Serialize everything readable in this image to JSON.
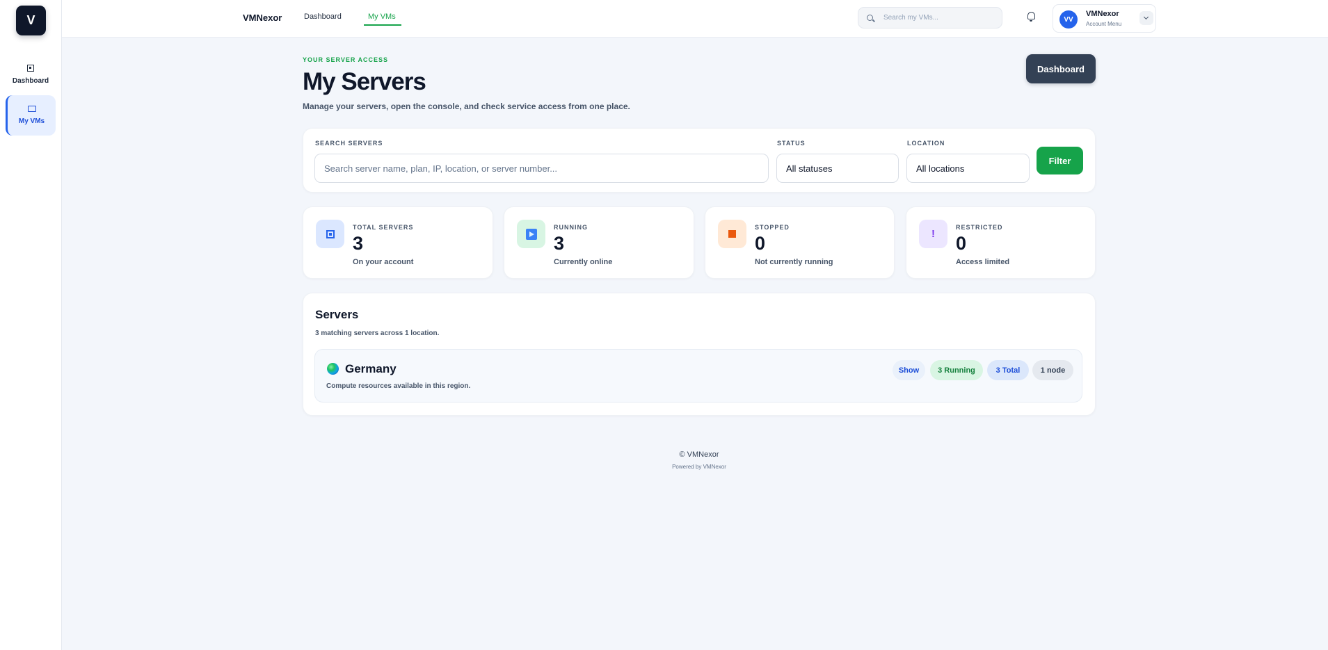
{
  "sidebar": {
    "logo_letter": "V",
    "items": [
      {
        "label": "Dashboard",
        "icon": "dashboard-icon"
      },
      {
        "label": "My VMs",
        "icon": "monitor-icon"
      }
    ]
  },
  "topbar": {
    "brand": "VMNexor",
    "nav": [
      {
        "label": "Dashboard"
      },
      {
        "label": "My VMs"
      }
    ],
    "search_placeholder": "Search my VMs...",
    "account": {
      "initials": "VV",
      "name": "VMNexor",
      "subtitle": "Account Menu"
    }
  },
  "header": {
    "eyebrow": "YOUR SERVER ACCESS",
    "title": "My Servers",
    "subtitle": "Manage your servers, open the console, and check service access from one place.",
    "dashboard_button": "Dashboard"
  },
  "filters": {
    "search_label": "SEARCH SERVERS",
    "search_placeholder": "Search server name, plan, IP, location, or server number...",
    "status_label": "STATUS",
    "status_value": "All statuses",
    "location_label": "LOCATION",
    "location_value": "All locations",
    "filter_button": "Filter"
  },
  "stats": [
    {
      "label": "TOTAL SERVERS",
      "value": "3",
      "note": "On your account",
      "icon": "server-icon",
      "color": "#2563eb"
    },
    {
      "label": "RUNNING",
      "value": "3",
      "note": "Currently online",
      "icon": "play-icon",
      "color": "#16a34a"
    },
    {
      "label": "STOPPED",
      "value": "0",
      "note": "Not currently running",
      "icon": "stop-icon",
      "color": "#ea580c"
    },
    {
      "label": "RESTRICTED",
      "value": "0",
      "note": "Access limited",
      "icon": "alert-icon",
      "color": "#7c3aed"
    }
  ],
  "servers": {
    "title": "Servers",
    "subtitle": "3 matching servers across 1 location.",
    "region": {
      "name": "Germany",
      "description": "Compute resources available in this region.",
      "show_label": "Show",
      "running_badge": "3 Running",
      "total_badge": "3 Total",
      "node_badge": "1 node"
    }
  },
  "footer": {
    "copyright": "© VMNexor",
    "powered": "Powered by VMNexor"
  }
}
